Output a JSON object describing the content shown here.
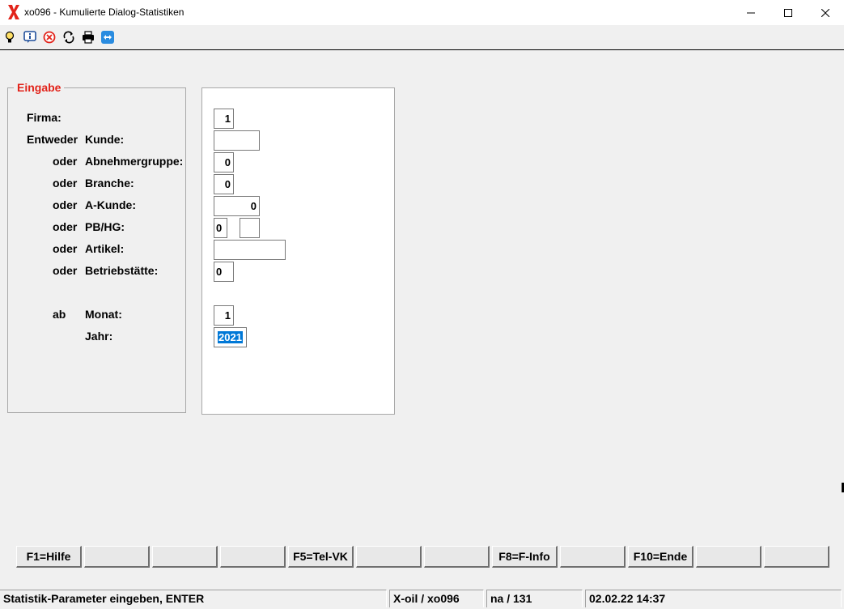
{
  "window": {
    "title": "xo096 - Kumulierte Dialog-Statistiken",
    "controls": [
      "minimize",
      "maximize",
      "close"
    ]
  },
  "toolbar": {
    "icons": [
      "lightbulb-icon",
      "info-icon",
      "cancel-icon",
      "refresh-icon",
      "printer-icon",
      "remote-icon"
    ]
  },
  "form": {
    "group_title": "Eingabe",
    "labels": {
      "firma": "Firma:",
      "entweder": "Entweder",
      "kunde": "Kunde:",
      "oder": "oder",
      "abnehmergruppe": "Abnehmergruppe:",
      "branche": "Branche:",
      "akunde": "A-Kunde:",
      "pbhg": "PB/HG:",
      "artikel": "Artikel:",
      "betriebstaette": "Betriebstätte:",
      "ab": "ab",
      "monat": "Monat:",
      "jahr": "Jahr:"
    },
    "values": {
      "firma": "1",
      "kunde": "",
      "abnehmergruppe": "0",
      "branche": "0",
      "akunde": "0",
      "pb": "0",
      "hg": "",
      "artikel": "",
      "betriebstaette": "0",
      "monat": "1",
      "jahr": "2021"
    }
  },
  "function_keys": [
    "F1=Hilfe",
    "",
    "",
    "",
    "F5=Tel-VK",
    "",
    "",
    "F8=F-Info",
    "",
    "F10=Ende",
    "",
    ""
  ],
  "status": {
    "message": "Statistik-Parameter eingeben, ENTER",
    "program": "X-oil / xo096",
    "user": "na / 131",
    "datetime": "02.02.22 14:37"
  },
  "colors": {
    "accent_red": "#e2231a",
    "selection_blue": "#0078d7"
  }
}
